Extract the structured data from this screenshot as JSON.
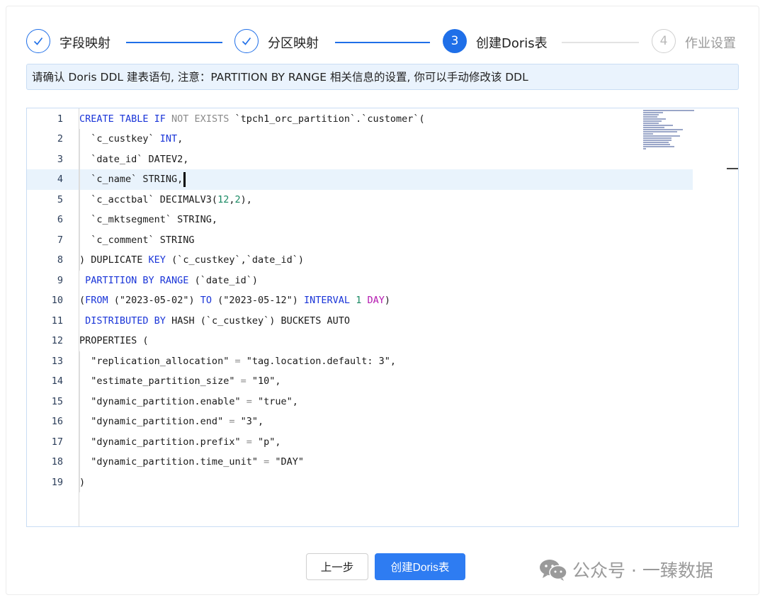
{
  "steps": [
    {
      "label": "字段映射",
      "state": "done",
      "icon": "check-icon"
    },
    {
      "label": "分区映射",
      "state": "done",
      "icon": "check-icon"
    },
    {
      "label": "创建Doris表",
      "state": "active",
      "number": "3"
    },
    {
      "label": "作业设置",
      "state": "wait",
      "number": "4"
    }
  ],
  "notice": "请确认 Doris DDL 建表语句, 注意：PARTITION BY RANGE 相关信息的设置, 你可以手动修改该 DDL",
  "editor": {
    "current_line": 4,
    "lines": [
      {
        "no": "1",
        "tokens": [
          [
            "k",
            "CREATE TABLE IF "
          ],
          [
            "g",
            "NOT EXISTS "
          ],
          [
            "t",
            "`tpch1_orc_partition`.`customer`("
          ]
        ]
      },
      {
        "no": "2",
        "tokens": [
          [
            "t",
            "  `c_custkey` "
          ],
          [
            "k",
            "INT"
          ],
          [
            "t",
            ","
          ]
        ]
      },
      {
        "no": "3",
        "tokens": [
          [
            "t",
            "  `date_id` DATEV2,"
          ]
        ]
      },
      {
        "no": "4",
        "tokens": [
          [
            "t",
            "  `c_name` STRING,"
          ]
        ]
      },
      {
        "no": "5",
        "tokens": [
          [
            "t",
            "  `c_acctbal` DECIMALV3("
          ],
          [
            "n",
            "12"
          ],
          [
            "t",
            ","
          ],
          [
            "n",
            "2"
          ],
          [
            "t",
            "),"
          ]
        ]
      },
      {
        "no": "6",
        "tokens": [
          [
            "t",
            "  `c_mktsegment` STRING,"
          ]
        ]
      },
      {
        "no": "7",
        "tokens": [
          [
            "t",
            "  `c_comment` STRING"
          ]
        ]
      },
      {
        "no": "8",
        "tokens": [
          [
            "t",
            ") DUPLICATE "
          ],
          [
            "k",
            "KEY"
          ],
          [
            "t",
            " (`c_custkey`,`date_id`)"
          ]
        ]
      },
      {
        "no": "9",
        "tokens": [
          [
            "t",
            " "
          ],
          [
            "k",
            "PARTITION BY RANGE"
          ],
          [
            "t",
            " (`date_id`)"
          ]
        ]
      },
      {
        "no": "10",
        "tokens": [
          [
            "t",
            "("
          ],
          [
            "k",
            "FROM"
          ],
          [
            "t",
            " (\"2023-05-02\") "
          ],
          [
            "k",
            "TO"
          ],
          [
            "t",
            " (\"2023-05-12\") "
          ],
          [
            "k",
            "INTERVAL"
          ],
          [
            "t",
            " "
          ],
          [
            "n",
            "1"
          ],
          [
            "t",
            " "
          ],
          [
            "m",
            "DAY"
          ],
          [
            "t",
            ")"
          ]
        ]
      },
      {
        "no": "11",
        "tokens": [
          [
            "t",
            " "
          ],
          [
            "k",
            "DISTRIBUTED BY"
          ],
          [
            "t",
            " HASH (`c_custkey`) BUCKETS AUTO"
          ]
        ]
      },
      {
        "no": "12",
        "tokens": [
          [
            "t",
            "PROPERTIES ("
          ]
        ]
      },
      {
        "no": "13",
        "tokens": [
          [
            "t",
            "  \"replication_allocation\" "
          ],
          [
            "g",
            "="
          ],
          [
            "t",
            " \"tag.location.default: 3\","
          ]
        ]
      },
      {
        "no": "14",
        "tokens": [
          [
            "t",
            "  \"estimate_partition_size\" "
          ],
          [
            "g",
            "="
          ],
          [
            "t",
            " \"10\","
          ]
        ]
      },
      {
        "no": "15",
        "tokens": [
          [
            "t",
            "  \"dynamic_partition.enable\" "
          ],
          [
            "g",
            "="
          ],
          [
            "t",
            " \"true\","
          ]
        ]
      },
      {
        "no": "16",
        "tokens": [
          [
            "t",
            "  \"dynamic_partition.end\" "
          ],
          [
            "g",
            "="
          ],
          [
            "t",
            " \"3\","
          ]
        ]
      },
      {
        "no": "17",
        "tokens": [
          [
            "t",
            "  \"dynamic_partition.prefix\" "
          ],
          [
            "g",
            "="
          ],
          [
            "t",
            " \"p\","
          ]
        ]
      },
      {
        "no": "18",
        "tokens": [
          [
            "t",
            "  \"dynamic_partition.time_unit\" "
          ],
          [
            "g",
            "="
          ],
          [
            "t",
            " \"DAY\""
          ]
        ]
      },
      {
        "no": "19",
        "tokens": [
          [
            "t",
            ")"
          ]
        ]
      }
    ]
  },
  "buttons": {
    "prev": "上一步",
    "create": "创建Doris表"
  },
  "watermark": {
    "text": "公众号 · 一臻数据",
    "icon": "wechat-icon"
  },
  "colors": {
    "primary": "#1f6fe8",
    "button_primary": "#2e7cf2",
    "notice_bg": "#eaf3fd",
    "keyword": "#1a35d8",
    "number": "#1a8a64",
    "magenta": "#b418b0"
  }
}
